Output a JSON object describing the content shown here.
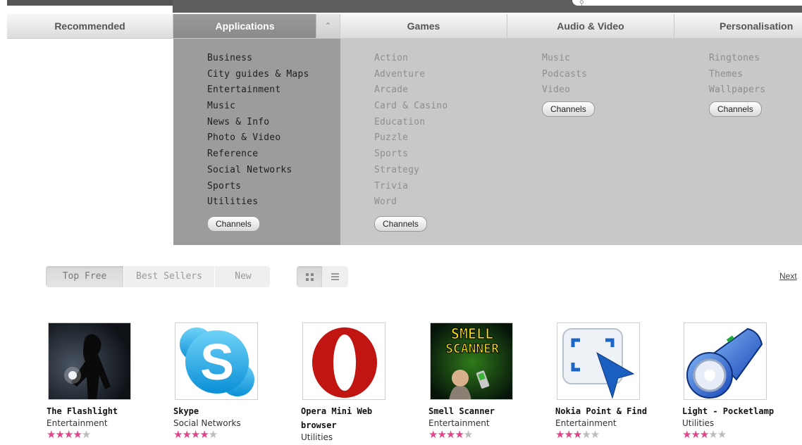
{
  "tabs": [
    {
      "label": "Recommended"
    },
    {
      "label": "Applications"
    },
    {
      "label": "Games"
    },
    {
      "label": "Audio & Video"
    },
    {
      "label": "Personalisation"
    }
  ],
  "menu": {
    "applications": [
      "Business",
      "City guides & Maps",
      "Entertainment",
      "Music",
      "News & Info",
      "Photo & Video",
      "Reference",
      "Social Networks",
      "Sports",
      "Utilities"
    ],
    "games": [
      "Action",
      "Adventure",
      "Arcade",
      "Card & Casino",
      "Education",
      "Puzzle",
      "Sports",
      "Strategy",
      "Trivia",
      "Word"
    ],
    "audio_video": [
      "Music",
      "Podcasts",
      "Video"
    ],
    "personalisation": [
      "Ringtones",
      "Themes",
      "Wallpapers"
    ],
    "channels_label": "Channels"
  },
  "filter": {
    "tabs": [
      "Top Free",
      "Best Sellers",
      "New"
    ],
    "selected": "Top Free"
  },
  "next_label": "Next",
  "apps": [
    {
      "name": "The Flashlight",
      "category": "Entertainment",
      "rating": 4
    },
    {
      "name": "Skype",
      "category": "Social Networks",
      "rating": 4
    },
    {
      "name_line1": "Opera Mini Web",
      "name_line2": "browser",
      "category": "Utilities"
    },
    {
      "name": "Smell Scanner",
      "category": "Entertainment",
      "rating": 4,
      "logo_text_1": "SMELL",
      "logo_text_2": "SCANNER"
    },
    {
      "name": "Nokia Point & Find",
      "category": "Entertainment",
      "rating": 3
    },
    {
      "name": "Light - Pocketlamp",
      "category": "Utilities",
      "rating": 3
    }
  ],
  "colors": {
    "star": "#e0448a",
    "active_tab": "#8f8f8f",
    "menu_bg": "#c8c8c8",
    "menu_active_col": "#9c9c9c"
  }
}
